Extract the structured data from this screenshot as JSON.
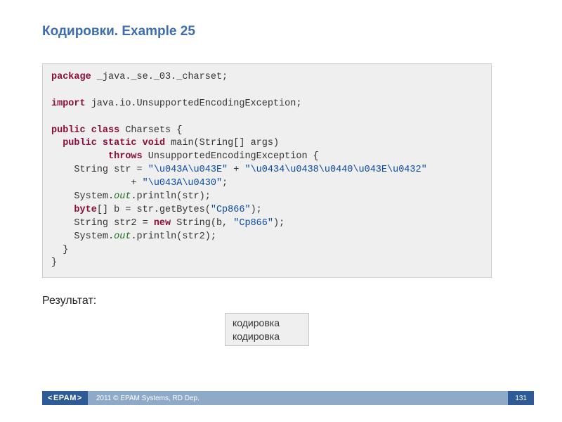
{
  "title": "Кодировки. Example 25",
  "code": {
    "package_kw": "package",
    "package_name": " _java._se._03._charset;",
    "import_kw": "import",
    "import_name": " java.io.UnsupportedEncodingException;",
    "public_kw": "public",
    "class_kw": "class",
    "class_name": " Charsets {",
    "static_kw": "static",
    "void_kw": "void",
    "main_sig": " main(String[] args)",
    "throws_kw": "throws",
    "throws_name": " UnsupportedEncodingException {",
    "line_str_decl": "    String str = ",
    "str1": "\"\\u043A\\u043E\"",
    "plus": " + ",
    "str2": "\"\\u0434\\u0438\\u0440\\u043E\\u0432\"",
    "line_cont_plus": "              + ",
    "str3": "\"\\u043A\\u0430\"",
    "semicolon": ";",
    "sysout1_a": "    System.",
    "out_field": "out",
    "sysout1_b": ".println(str);",
    "byte_kw": "byte",
    "byte_line_a": "[] b = str.getBytes(",
    "cp866": "\"Cp866\"",
    "byte_line_b": ");",
    "str2_decl_a": "    String str2 = ",
    "new_kw": "new",
    "str2_decl_b": " String(b, ",
    "str2_decl_c": ");",
    "sysout2_a": "    System.",
    "sysout2_b": ".println(str2);",
    "close_method": "  }",
    "close_class": "}"
  },
  "result_label": "Результат:",
  "result": {
    "line1": "кодировка",
    "line2": "кодировка"
  },
  "footer": {
    "logo": "EPAM",
    "text": "2011 © EPAM Systems, RD Dep.",
    "page": "131"
  }
}
